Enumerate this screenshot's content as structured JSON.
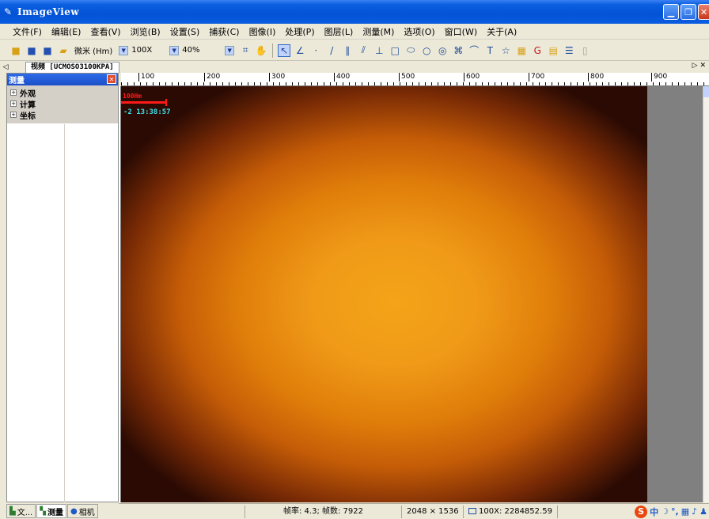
{
  "window": {
    "title": "ImageView"
  },
  "menu": [
    "文件(F)",
    "编辑(E)",
    "查看(V)",
    "浏览(B)",
    "设置(S)",
    "捕获(C)",
    "图像(I)",
    "处理(P)",
    "图层(L)",
    "测量(M)",
    "选项(O)",
    "窗口(W)",
    "关于(A)"
  ],
  "toolbar": {
    "unit_label": "微米 (Hm)",
    "zoom_value": "100X",
    "scale_value": "40%"
  },
  "tabs": {
    "doc_tab": "视频 [UCMOSO3100KPA]"
  },
  "left_panel": {
    "title": "测量",
    "tree": [
      "外观",
      "计算",
      "坐标"
    ]
  },
  "bottom_tabs": [
    "文...",
    "测量",
    "相机"
  ],
  "ruler": {
    "marks": [
      "100",
      "200",
      "300",
      "400",
      "500",
      "600",
      "700",
      "800",
      "900"
    ]
  },
  "overlay": {
    "scale_label": "100Hm",
    "timestamp": "-2 13:38:57"
  },
  "status": {
    "fps": "帧率: 4.3; 帧数: 7922",
    "resolution": "2048 × 1536",
    "zoom_info": "100X: 2284852.59"
  },
  "ime": {
    "mode": "中"
  },
  "colors": {
    "titlebar": "#0453D6",
    "overlay_red": "#FF1A1A",
    "overlay_cyan": "#3FE0E8"
  }
}
